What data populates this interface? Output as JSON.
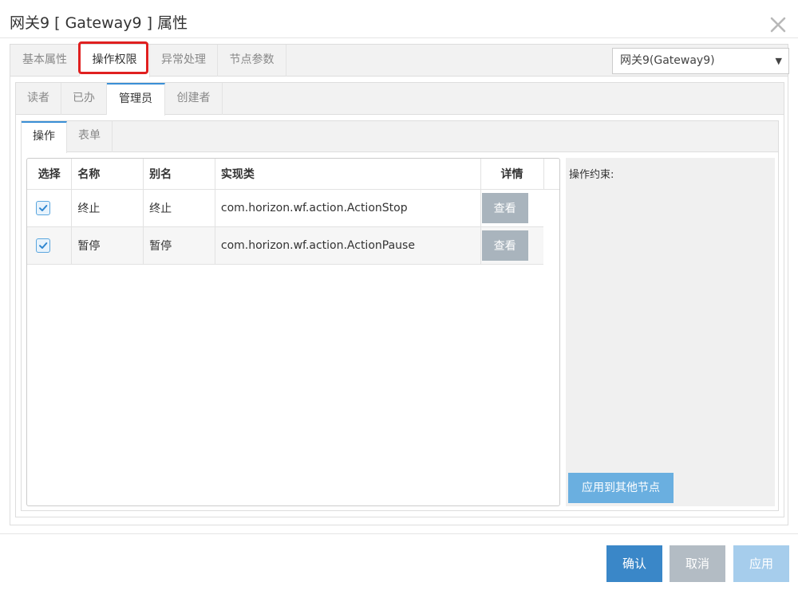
{
  "dialog": {
    "title": "网关9 [ Gateway9 ] 属性",
    "close_icon": "close-icon"
  },
  "top_tabs": [
    {
      "label": "基本属性",
      "active": false
    },
    {
      "label": "操作权限",
      "active": true,
      "highlighted": true
    },
    {
      "label": "异常处理",
      "active": false
    },
    {
      "label": "节点参数",
      "active": false
    }
  ],
  "gateway_select": {
    "value": "网关9(Gateway9)",
    "icon": "caret-down-icon"
  },
  "role_tabs": [
    {
      "label": "读者",
      "active": false
    },
    {
      "label": "已办",
      "active": false
    },
    {
      "label": "管理员",
      "active": true
    },
    {
      "label": "创建者",
      "active": false
    }
  ],
  "sub_tabs": [
    {
      "label": "操作",
      "active": true
    },
    {
      "label": "表单",
      "active": false
    }
  ],
  "grid": {
    "columns": [
      "选择",
      "名称",
      "别名",
      "实现类",
      "详情"
    ],
    "rows": [
      {
        "checked": true,
        "name": "终止",
        "alias": "终止",
        "class": "com.horizon.wf.action.ActionStop",
        "detail_button": "查看"
      },
      {
        "checked": true,
        "name": "暂停",
        "alias": "暂停",
        "class": "com.horizon.wf.action.ActionPause",
        "detail_button": "查看"
      }
    ]
  },
  "side_panel": {
    "label": "操作约束:",
    "apply_button": "应用到其他节点"
  },
  "footer": {
    "confirm": "确认",
    "cancel": "取消",
    "apply": "应用"
  },
  "colors": {
    "highlight": "#e02020",
    "primary": "#3a87c8",
    "disabled": "#b3bcc4",
    "accent_light": "#6aafe0"
  }
}
